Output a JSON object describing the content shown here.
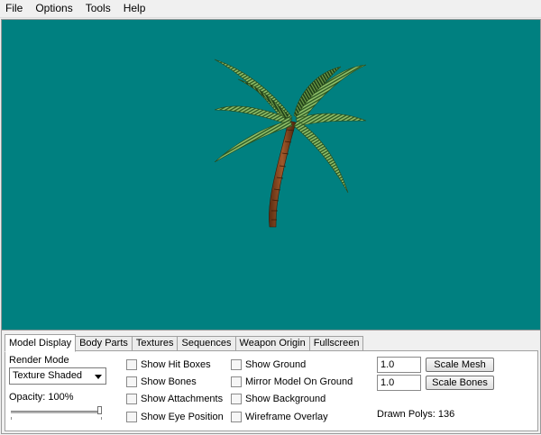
{
  "menu": {
    "items": [
      "File",
      "Options",
      "Tools",
      "Help"
    ]
  },
  "viewport": {
    "background_color": "#008080",
    "model": "palm-tree"
  },
  "panel": {
    "tabs": [
      {
        "label": "Model Display",
        "active": true
      },
      {
        "label": "Body Parts",
        "active": false
      },
      {
        "label": "Textures",
        "active": false
      },
      {
        "label": "Sequences",
        "active": false
      },
      {
        "label": "Weapon Origin",
        "active": false
      },
      {
        "label": "Fullscreen",
        "active": false
      }
    ],
    "render_mode": {
      "label": "Render Mode",
      "value": "Texture Shaded"
    },
    "opacity": {
      "label": "Opacity: 100%",
      "value": 1.0
    },
    "checkboxes_col1": [
      {
        "label": "Show Hit Boxes",
        "checked": false
      },
      {
        "label": "Show Bones",
        "checked": false
      },
      {
        "label": "Show Attachments",
        "checked": false
      },
      {
        "label": "Show Eye Position",
        "checked": false
      }
    ],
    "checkboxes_col2": [
      {
        "label": "Show Ground",
        "checked": false
      },
      {
        "label": "Mirror Model On Ground",
        "checked": false
      },
      {
        "label": "Show Background",
        "checked": false
      },
      {
        "label": "Wireframe Overlay",
        "checked": false
      }
    ],
    "scale_mesh": {
      "value": "1.0",
      "button": "Scale Mesh"
    },
    "scale_bones": {
      "value": "1.0",
      "button": "Scale Bones"
    },
    "drawn_polys": "Drawn Polys: 136"
  }
}
